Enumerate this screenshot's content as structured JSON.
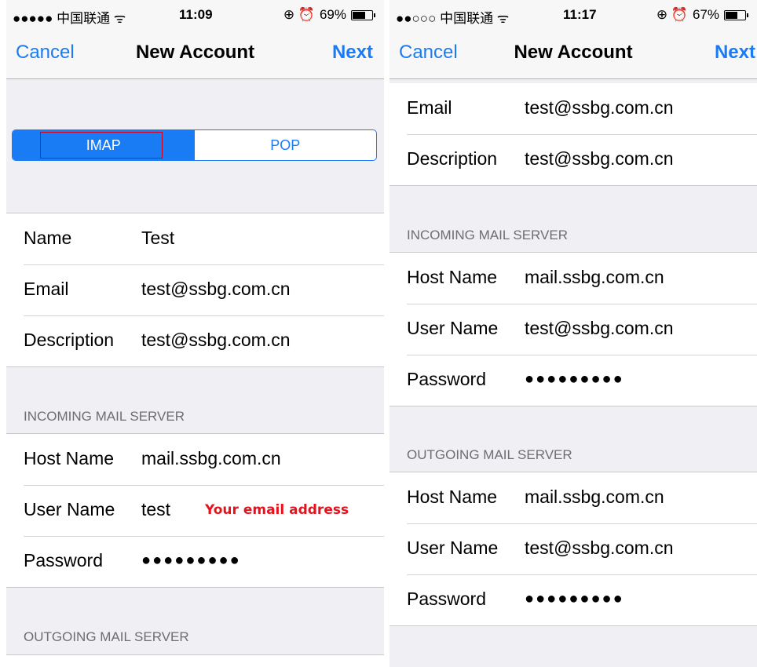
{
  "left": {
    "status": {
      "carrier": "●●●●● 中国联通 ᯤ",
      "time": "11:09",
      "battery_text": "69%",
      "icons": "⊕ ⏰",
      "battery_level": 0.69
    },
    "nav": {
      "cancel": "Cancel",
      "title": "New Account",
      "next": "Next"
    },
    "segment": {
      "selected": "IMAP",
      "other": "POP"
    },
    "account": [
      {
        "label": "Name",
        "value": "Test"
      },
      {
        "label": "Email",
        "value": "test@ssbg.com.cn"
      },
      {
        "label": "Description",
        "value": "test@ssbg.com.cn"
      }
    ],
    "incoming_header": "INCOMING MAIL SERVER",
    "incoming": [
      {
        "label": "Host Name",
        "value": "mail.ssbg.com.cn"
      },
      {
        "label": "User Name",
        "value": "test"
      },
      {
        "label": "Password",
        "value": "●●●●●●●●●"
      }
    ],
    "annotation": "Your email address",
    "outgoing_header": "OUTGOING MAIL SERVER"
  },
  "right": {
    "status": {
      "carrier": "●●○○○ 中国联通 ᯤ",
      "time": "11:17",
      "battery_text": "67%",
      "icons": "⊕ ⏰",
      "battery_level": 0.67
    },
    "nav": {
      "cancel": "Cancel",
      "title": "New Account",
      "next": "Next"
    },
    "account": [
      {
        "label": "Email",
        "value": "test@ssbg.com.cn"
      },
      {
        "label": "Description",
        "value": "test@ssbg.com.cn"
      }
    ],
    "incoming_header": "INCOMING MAIL SERVER",
    "incoming": [
      {
        "label": "Host Name",
        "value": "mail.ssbg.com.cn"
      },
      {
        "label": "User Name",
        "value": "test@ssbg.com.cn"
      },
      {
        "label": "Password",
        "value": "●●●●●●●●●"
      }
    ],
    "outgoing_header": "OUTGOING MAIL SERVER",
    "outgoing": [
      {
        "label": "Host Name",
        "value": "mail.ssbg.com.cn"
      },
      {
        "label": "User Name",
        "value": "test@ssbg.com.cn"
      },
      {
        "label": "Password",
        "value": "●●●●●●●●●"
      }
    ]
  },
  "colors": {
    "accent": "#1a7cf5",
    "annotation": "#e8101a",
    "grouped_bg": "#efeff4"
  }
}
